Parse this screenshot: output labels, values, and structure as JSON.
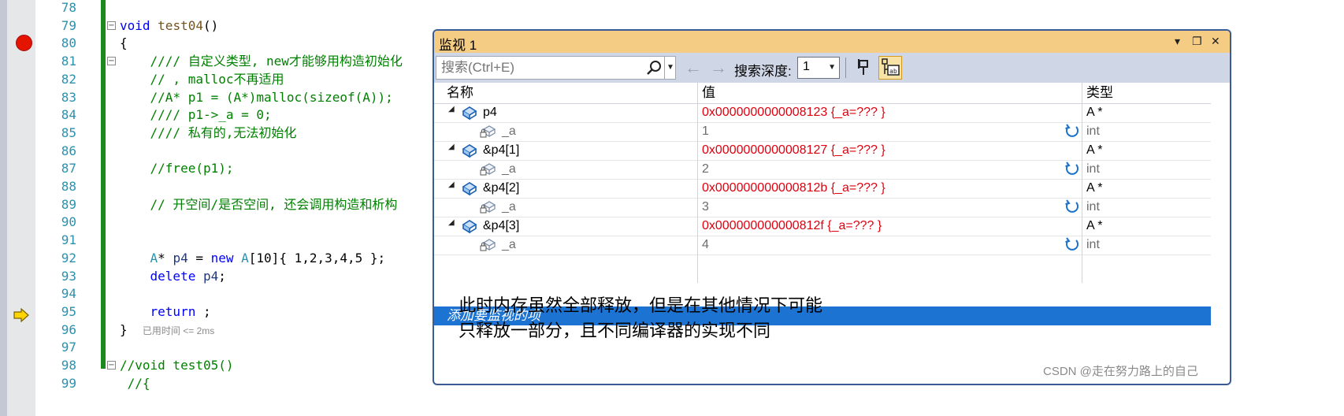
{
  "editor": {
    "lines": [
      {
        "n": "78",
        "fold": "",
        "parts": []
      },
      {
        "n": "79",
        "fold": "⊟",
        "parts": [
          {
            "c": "kw",
            "t": "void "
          },
          {
            "c": "fn",
            "t": "test04"
          },
          {
            "c": "tx",
            "t": "()"
          }
        ]
      },
      {
        "n": "80",
        "fold": "",
        "parts": [
          {
            "c": "tx",
            "t": "{"
          }
        ]
      },
      {
        "n": "81",
        "fold": "⊟",
        "parts": [
          {
            "c": "cm",
            "t": "    //// 自定义类型, new才能够用构造初始化"
          }
        ]
      },
      {
        "n": "82",
        "fold": "",
        "parts": [
          {
            "c": "cm",
            "t": "    // , malloc不再适用"
          }
        ]
      },
      {
        "n": "83",
        "fold": "",
        "parts": [
          {
            "c": "cm",
            "t": "    //A* p1 = (A*)malloc(sizeof(A));"
          }
        ]
      },
      {
        "n": "84",
        "fold": "",
        "parts": [
          {
            "c": "cm",
            "t": "    //// p1->_a = 0;"
          }
        ]
      },
      {
        "n": "85",
        "fold": "",
        "parts": [
          {
            "c": "cm",
            "t": "    //// 私有的,无法初始化"
          }
        ]
      },
      {
        "n": "86",
        "fold": "",
        "parts": []
      },
      {
        "n": "87",
        "fold": "",
        "parts": [
          {
            "c": "cm",
            "t": "    //free(p1);"
          }
        ]
      },
      {
        "n": "88",
        "fold": "",
        "parts": []
      },
      {
        "n": "89",
        "fold": "",
        "parts": [
          {
            "c": "cm",
            "t": "    // 开空间/是否空间, 还会调用构造和析构"
          }
        ]
      },
      {
        "n": "90",
        "fold": "",
        "parts": []
      },
      {
        "n": "91",
        "fold": "",
        "parts": []
      },
      {
        "n": "92",
        "fold": "",
        "parts": [
          {
            "c": "ty",
            "t": "    A"
          },
          {
            "c": "tx",
            "t": "* "
          },
          {
            "c": "va",
            "t": "p4"
          },
          {
            "c": "tx",
            "t": " = "
          },
          {
            "c": "kw",
            "t": "new "
          },
          {
            "c": "ty",
            "t": "A"
          },
          {
            "c": "tx",
            "t": "[10]{ 1,2,3,4,5 };"
          }
        ]
      },
      {
        "n": "93",
        "fold": "",
        "parts": [
          {
            "c": "kw",
            "t": "    delete "
          },
          {
            "c": "va",
            "t": "p4"
          },
          {
            "c": "tx",
            "t": ";"
          }
        ]
      },
      {
        "n": "94",
        "fold": "",
        "parts": []
      },
      {
        "n": "95",
        "fold": "",
        "parts": [
          {
            "c": "kw",
            "t": "    return "
          },
          {
            "c": "tx",
            "t": ";"
          }
        ]
      },
      {
        "n": "96",
        "fold": "",
        "parts": [
          {
            "c": "tx",
            "t": "}  "
          },
          {
            "c": "hint",
            "t": "已用时间 <= 2ms"
          }
        ]
      },
      {
        "n": "97",
        "fold": "",
        "parts": []
      },
      {
        "n": "98",
        "fold": "⊟",
        "parts": [
          {
            "c": "cm",
            "t": "//void test05()"
          }
        ]
      },
      {
        "n": "99",
        "fold": "",
        "parts": [
          {
            "c": "cm",
            "t": " //{"
          }
        ]
      }
    ]
  },
  "watch": {
    "title": "监视 1",
    "title_buttons": [
      "▾",
      "❐",
      "✕"
    ],
    "search_placeholder": "搜索(Ctrl+E)",
    "depth_label": "搜索深度:",
    "depth_value": "1",
    "columns": {
      "name": "名称",
      "value": "值",
      "type": "类型"
    },
    "rows": [
      {
        "level": 0,
        "name": "p4",
        "value": "0x0000000000008123 {_a=??? }",
        "type": "A *"
      },
      {
        "level": 1,
        "name": "_a",
        "value": "1",
        "type": "int"
      },
      {
        "level": 0,
        "name": "&p4[1]",
        "value": "0x0000000000008127 {_a=??? }",
        "type": "A *"
      },
      {
        "level": 1,
        "name": "_a",
        "value": "2",
        "type": "int"
      },
      {
        "level": 0,
        "name": "&p4[2]",
        "value": "0x000000000000812b {_a=??? }",
        "type": "A *"
      },
      {
        "level": 1,
        "name": "_a",
        "value": "3",
        "type": "int"
      },
      {
        "level": 0,
        "name": "&p4[3]",
        "value": "0x000000000000812f {_a=??? }",
        "type": "A *"
      },
      {
        "level": 1,
        "name": "_a",
        "value": "4",
        "type": "int"
      }
    ],
    "add_item": "添加要监视的项"
  },
  "note": {
    "line1": "此时内存虽然全部释放，但是在其他情况下可能",
    "line2": "只释放一部分，且不同编译器的实现不同"
  },
  "watermark": "CSDN @走在努力路上的自己",
  "colors": {
    "value_red": "#e0000f",
    "selection": "#1c73d2",
    "title_bar": "#f5cc84",
    "change_bar": "#1e8a1e"
  }
}
